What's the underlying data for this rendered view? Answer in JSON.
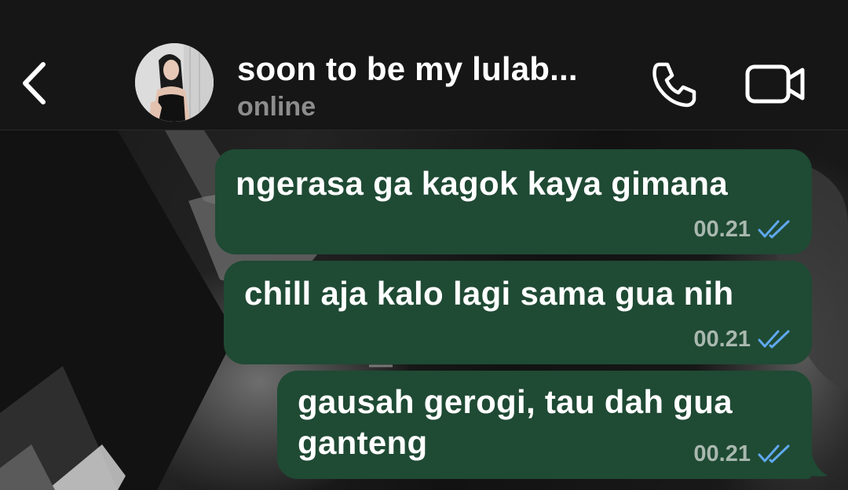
{
  "header": {
    "back_icon": "chevron-left-icon",
    "contact_name": "soon to be my lulab...",
    "status": "online",
    "call_icon": "phone-icon",
    "video_icon": "video-camera-icon"
  },
  "messages": [
    {
      "text": "ngerasa ga kagok kaya gimana",
      "time": "00.21",
      "status_icon": "double-check-icon"
    },
    {
      "text": "chill aja kalo lagi sama gua nih",
      "time": "00.21",
      "status_icon": "double-check-icon"
    },
    {
      "text": "gausah gerogi, tau dah gua ganteng",
      "time": "00.21",
      "status_icon": "double-check-icon"
    }
  ],
  "colors": {
    "header_bg": "#161616",
    "bubble_bg": "#1f4a34",
    "read_tick": "#5fa8f0",
    "status_text": "#8d8d8d"
  }
}
